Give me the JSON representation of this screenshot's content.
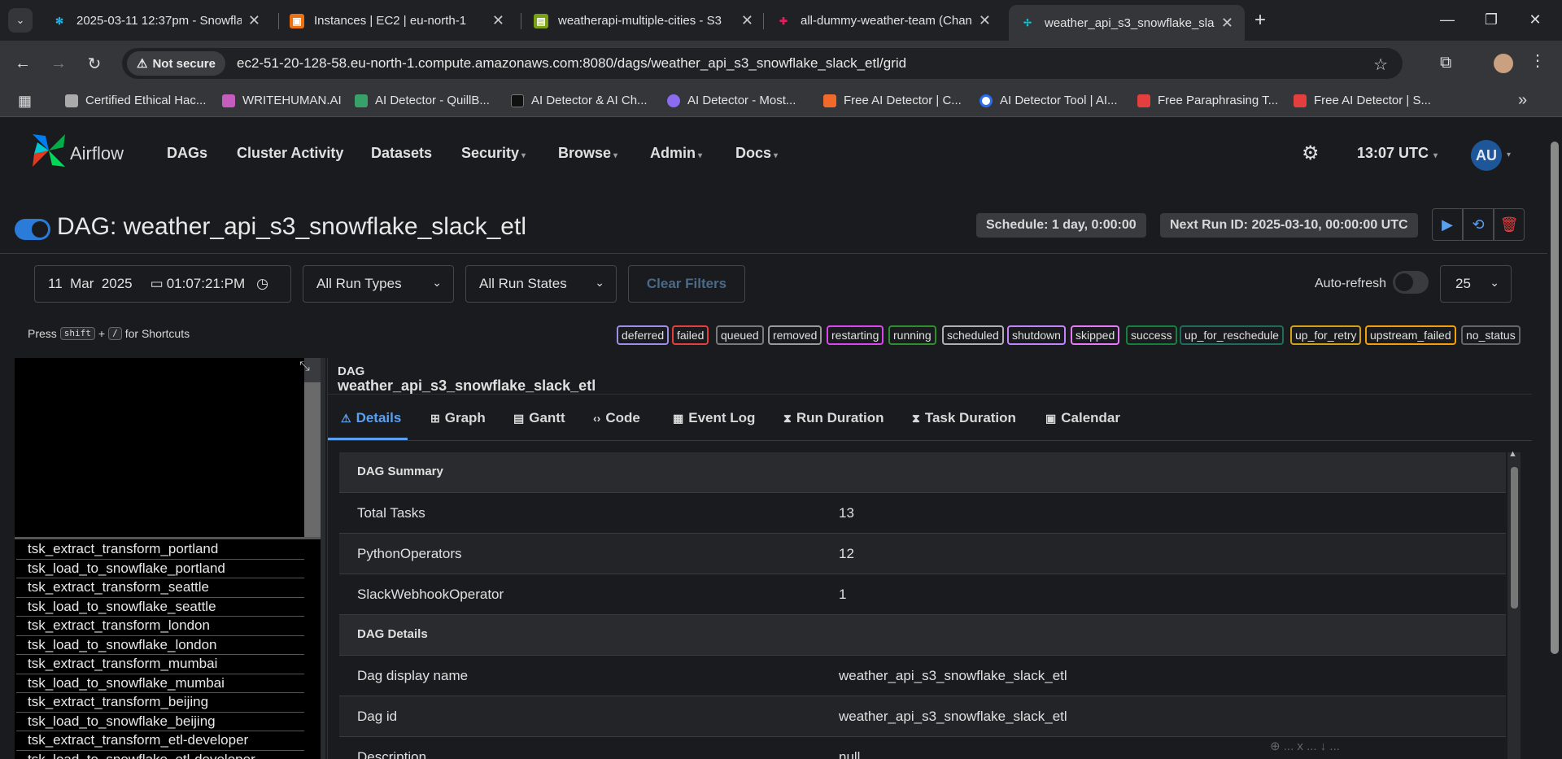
{
  "browser": {
    "tabs": [
      {
        "title": "2025-03-11 12:37pm - Snowflak",
        "favicon_color": "#29b5e8"
      },
      {
        "title": "Instances | EC2 | eu-north-1",
        "favicon_color": "#ec7211"
      },
      {
        "title": "weatherapi-multiple-cities - S3",
        "favicon_color": "#7aa116"
      },
      {
        "title": "all-dummy-weather-team (Chan",
        "favicon_color": "#e01e5a"
      },
      {
        "title": "weather_api_s3_snowflake_slack",
        "favicon_color": "#00c7d4"
      }
    ],
    "security_label": "Not secure",
    "url": "ec2-51-20-128-58.eu-north-1.compute.amazonaws.com:8080/dags/weather_api_s3_snowflake_slack_etl/grid",
    "bookmarks": [
      {
        "label": "Certified Ethical Hac...",
        "color": "#aaaaaa"
      },
      {
        "label": "WRITEHUMAN.AI",
        "color": "#c55dbf"
      },
      {
        "label": "AI Detector - QuillB...",
        "color": "#38a169"
      },
      {
        "label": "AI Detector & AI Ch...",
        "color": "#111111"
      },
      {
        "label": "AI Detector - Most...",
        "color": "#8b6cf0"
      },
      {
        "label": "Free AI Detector | C...",
        "color": "#f06a2c"
      },
      {
        "label": "AI Detector Tool | AI...",
        "color": "#2b6cf0"
      },
      {
        "label": "Free Paraphrasing T...",
        "color": "#e53e3e"
      },
      {
        "label": "Free AI Detector | S...",
        "color": "#e53e3e"
      }
    ]
  },
  "airflow": {
    "brand": "Airflow",
    "nav": [
      "DAGs",
      "Cluster Activity",
      "Datasets",
      "Security",
      "Browse",
      "Admin",
      "Docs"
    ],
    "time": "13:07 UTC",
    "user_initials": "AU",
    "dag_title": "DAG: weather_api_s3_snowflake_slack_etl",
    "schedule": "Schedule: 1 day, 0:00:00",
    "next_run": "Next Run ID: 2025-03-10, 00:00:00 UTC",
    "filters": {
      "date": "11  Mar  2025",
      "time": "01:07:21:PM",
      "run_types": "All Run Types",
      "run_states": "All Run States",
      "clear": "Clear Filters",
      "auto_refresh": "Auto-refresh",
      "page_size": "25"
    },
    "shortcuts": {
      "press": "Press",
      "key1": "shift",
      "plus": "+",
      "key2": "/",
      "suffix": "for Shortcuts"
    },
    "legend": [
      {
        "label": "deferred",
        "color": "#9b8fe6"
      },
      {
        "label": "failed",
        "color": "#e53e3e"
      },
      {
        "label": "queued",
        "color": "#7a7a7a"
      },
      {
        "label": "removed",
        "color": "#9a9a9a"
      },
      {
        "label": "restarting",
        "color": "#d946ef"
      },
      {
        "label": "running",
        "color": "#2f8f2f"
      },
      {
        "label": "scheduled",
        "color": "#b0b0b0"
      },
      {
        "label": "shutdown",
        "color": "#c084fc"
      },
      {
        "label": "skipped",
        "color": "#e879f9"
      },
      {
        "label": "success",
        "color": "#15803d"
      },
      {
        "label": "up_for_reschedule",
        "color": "#1f6b5c"
      },
      {
        "label": "up_for_retry",
        "color": "#d4a017"
      },
      {
        "label": "upstream_failed",
        "color": "#f59e0b"
      },
      {
        "label": "no_status",
        "color": "#666666"
      }
    ],
    "tasks": [
      "tsk_extract_transform_portland",
      "tsk_load_to_snowflake_portland",
      "tsk_extract_transform_seattle",
      "tsk_load_to_snowflake_seattle",
      "tsk_extract_transform_london",
      "tsk_load_to_snowflake_london",
      "tsk_extract_transform_mumbai",
      "tsk_load_to_snowflake_mumbai",
      "tsk_extract_transform_beijing",
      "tsk_load_to_snowflake_beijing",
      "tsk_extract_transform_etl-developer",
      "tsk_load_to_snowflake_etl-developer"
    ],
    "details": {
      "label": "DAG",
      "name": "weather_api_s3_snowflake_slack_etl",
      "tabs": [
        "Details",
        "Graph",
        "Gantt",
        "Code",
        "Event Log",
        "Run Duration",
        "Task Duration",
        "Calendar"
      ],
      "summary_head": "DAG Summary",
      "summary": [
        {
          "k": "Total Tasks",
          "v": "13"
        },
        {
          "k": "PythonOperators",
          "v": "12"
        },
        {
          "k": "SlackWebhookOperator",
          "v": "1"
        }
      ],
      "details_head": "DAG Details",
      "details_rows": [
        {
          "k": "Dag display name",
          "v": "weather_api_s3_snowflake_slack_etl"
        },
        {
          "k": "Dag id",
          "v": "weather_api_s3_snowflake_slack_etl"
        },
        {
          "k": "Description",
          "v": "null"
        }
      ],
      "faded_text": "⊕ ... x ... ↓ ..."
    }
  }
}
